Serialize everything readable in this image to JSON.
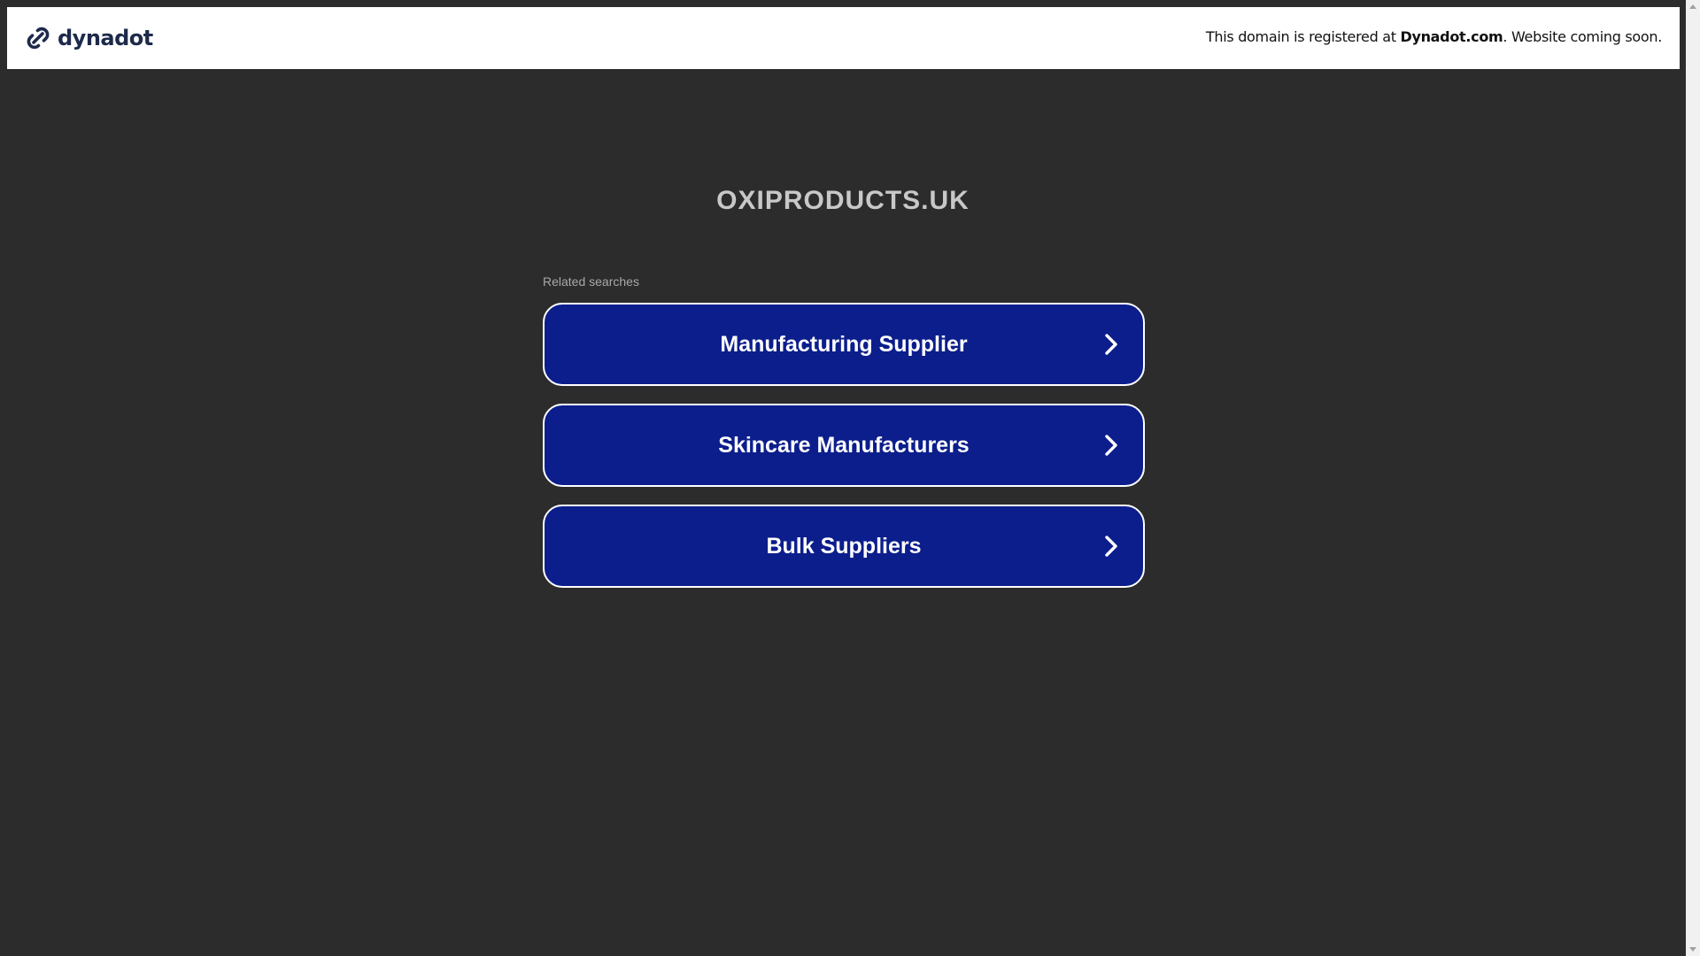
{
  "header": {
    "logo_text": "dynadot",
    "notice_prefix": "This domain is registered at ",
    "notice_brand": "Dynadot.com",
    "notice_suffix": ". Website coming soon."
  },
  "main": {
    "domain": "OXIPRODUCTS.UK",
    "related_label": "Related searches",
    "searches": [
      {
        "label": "Manufacturing Supplier"
      },
      {
        "label": "Skincare Manufacturers"
      },
      {
        "label": "Bulk Suppliers"
      }
    ]
  },
  "colors": {
    "background": "#2c2c2c",
    "button_fill": "#0c1e8c",
    "button_border": "#ffffff",
    "logo": "#1d2a4a"
  },
  "icons": {
    "logo": "dynadot-link-icon",
    "search_arrow": "chevron-right-icon"
  }
}
